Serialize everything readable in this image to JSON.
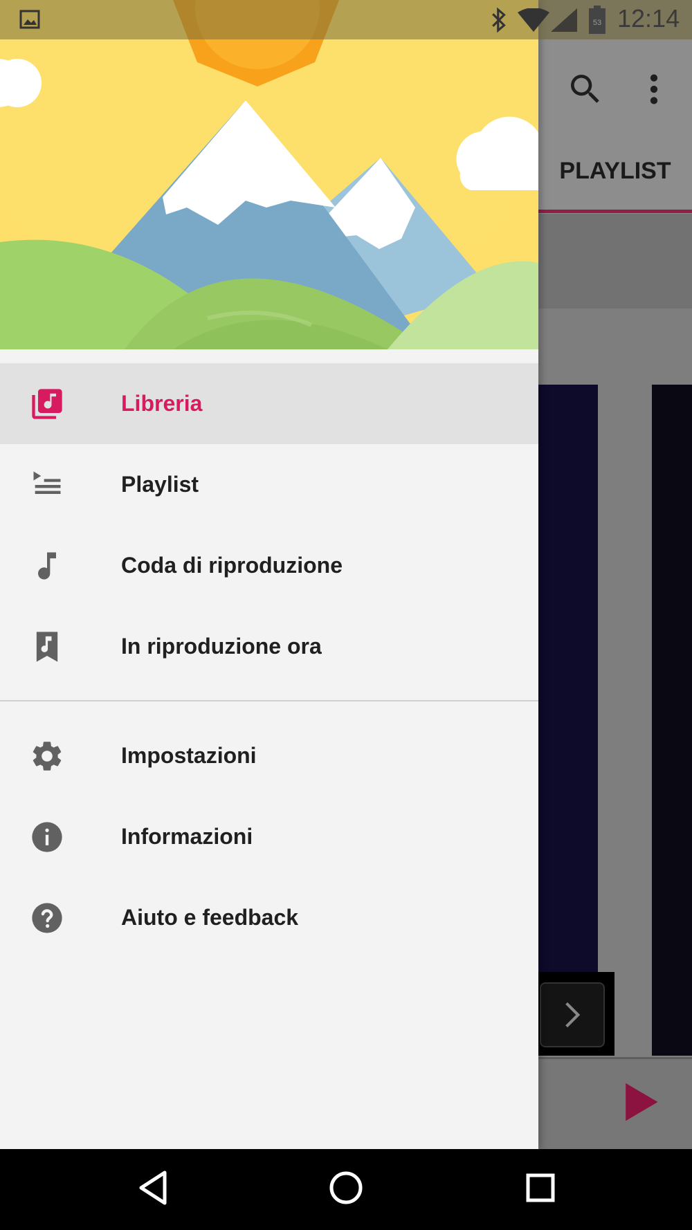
{
  "status_bar": {
    "time": "12:14",
    "battery_level": "53",
    "icons": [
      "image-notification-icon",
      "bluetooth-icon",
      "wifi-icon",
      "cell-signal-icon",
      "battery-icon"
    ]
  },
  "background_app": {
    "tab_label": "PLAYLIST",
    "toolbar_icons": [
      "search-icon",
      "more-vert-icon"
    ]
  },
  "drawer": {
    "header_image": "mountains-sun-illustration",
    "items": [
      {
        "label": "Libreria",
        "icon": "library-music-icon",
        "active": true
      },
      {
        "label": "Playlist",
        "icon": "playlist-icon",
        "active": false
      },
      {
        "label": "Coda di riproduzione",
        "icon": "music-note-icon",
        "active": false
      },
      {
        "label": "In riproduzione ora",
        "icon": "bookmark-music-icon",
        "active": false
      }
    ],
    "secondary_items": [
      {
        "label": "Impostazioni",
        "icon": "settings-gear-icon"
      },
      {
        "label": "Informazioni",
        "icon": "info-icon"
      },
      {
        "label": "Aiuto e feedback",
        "icon": "help-icon"
      }
    ]
  },
  "navigation_bar": {
    "icons": [
      "back-icon",
      "home-icon",
      "recents-icon"
    ]
  },
  "colors": {
    "accent": "#d81b60",
    "drawer_bg": "#f3f3f3",
    "active_item_bg": "#e1e1e1",
    "icon": "#616161"
  }
}
